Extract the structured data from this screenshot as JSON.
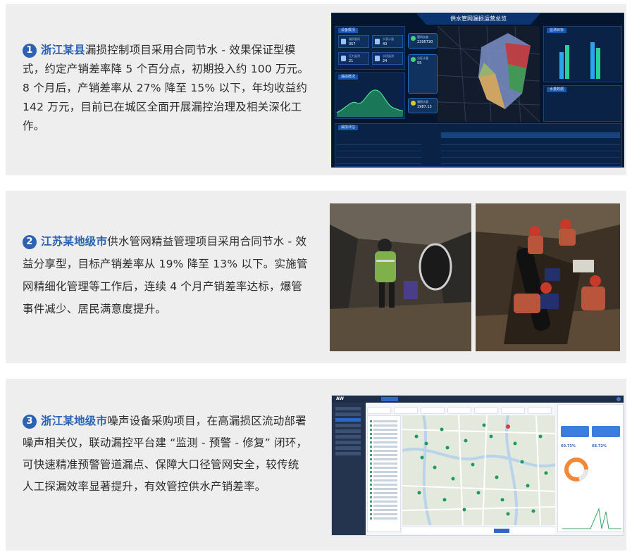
{
  "cases": [
    {
      "number": "1",
      "place": "浙江某县",
      "body": "漏损控制项目采用合同节水 - 效果保证型模式，约定产销差率降 5 个百分点，初期投入约 100 万元。8 个月后，产销差率从 27% 降至 15% 以下，年均收益约 142 万元，目前已在城区全面开展漏控治理及相关深化工作。",
      "image": {
        "title": "供水管网漏损运营总览",
        "panels": [
          "设备概况",
          "监测目标",
          "漏损概况",
          "水量数据",
          "漏损评估"
        ],
        "stats": [
          {
            "label": "漏损管网",
            "value": "357"
          },
          {
            "label": "大表计量",
            "value": "40"
          },
          {
            "label": "压力监测",
            "value": "21"
          },
          {
            "label": "水质监测",
            "value": "24"
          }
        ],
        "pills": [
          "2395730",
          "55",
          "1987.13"
        ]
      }
    },
    {
      "number": "2",
      "place": "江苏某地级市",
      "body": "供水管网精益管理项目采用合同节水 - 效益分享型，目标产销差率从 19% 降至 13% 以下。实施管网精细化管理等工作后，连续 4 个月产销差率达标，爆管事件减少、居民满意度提升。"
    },
    {
      "number": "3",
      "place": "浙江某地级市",
      "body": "噪声设备采购项目，在高漏损区流动部署噪声相关仪，联动漏控平台建 “监测 - 预警 - 修复” 闭环，可快速精准预警管道漏点、保障大口径管网安全，较传统人工探漏效率显著提升，有效管控供水产销差率。",
      "image": {
        "brand": "AW",
        "kpis": [
          "60.73%",
          "68.72%"
        ]
      }
    }
  ],
  "colors": {
    "accent": "#2b62b4",
    "card_bg": "#eeeeee",
    "text": "#2b2b2b"
  }
}
